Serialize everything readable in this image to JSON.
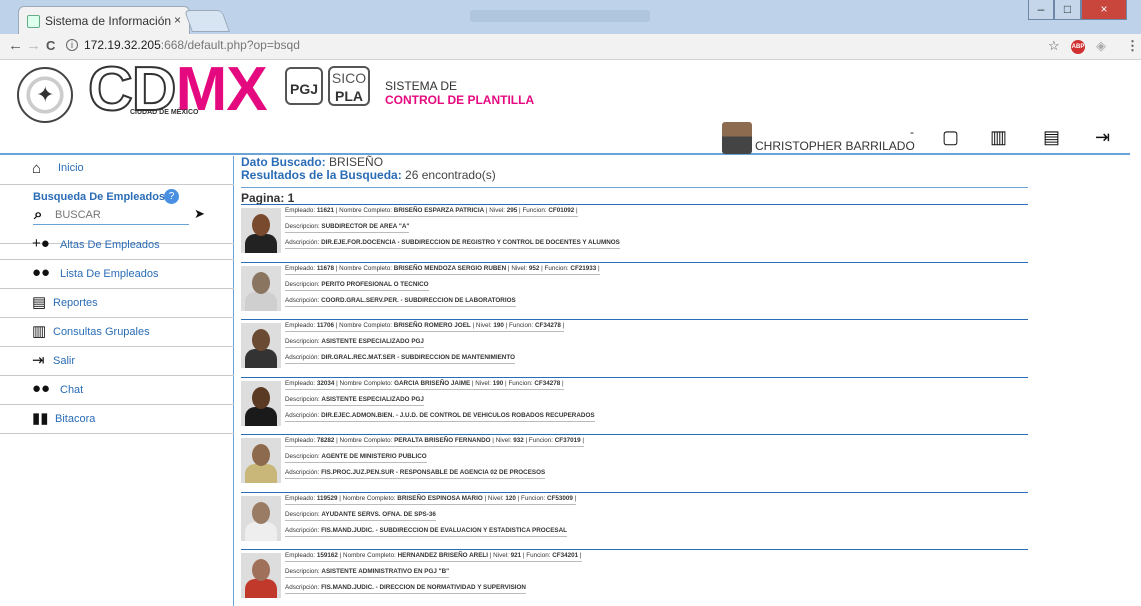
{
  "browser": {
    "tab_title": "Sistema de Información",
    "tab_close": "×",
    "url_host": "172.19.32.205",
    "url_path": ":668/default.php?op=bsqd",
    "back": "←",
    "forward": "→",
    "reload": "C",
    "info": "i",
    "star": "☆",
    "abp": "ABP",
    "minimize": "–",
    "maximize": "□",
    "close": "×"
  },
  "header": {
    "cdmx_cd": "CD",
    "cdmx_mx": "MX",
    "cdmx_sub": "CIUDAD DE MÉXICO",
    "pgj": "PGJ",
    "sico_top": "SICO",
    "sico_bottom": "PLA",
    "sistema_line1": "SISTEMA DE",
    "sistema_line2": "CONTROL DE PLANTILLA",
    "user_name": "CHRISTOPHER BARRILADO",
    "dash": "-"
  },
  "sidebar": {
    "inicio": "Inicio",
    "search_title": "Busqueda De Empleados:",
    "search_placeholder": "BUSCAR",
    "help": "?",
    "altas": "Altas De Empleados",
    "lista": "Lista De Empleados",
    "reportes": "Reportes",
    "consultas": "Consultas Grupales",
    "salir": "Salir",
    "chat": "Chat",
    "bitacora": "Bitacora"
  },
  "main": {
    "dato_label": "Dato Buscado:",
    "dato_value": " BRISEÑO",
    "result_label": "Resultados de la Busqueda:",
    "result_value": " 26 encontrado(s)",
    "pagina": "Pagina: 1",
    "records": [
      {
        "empleado": "11621",
        "nombre": "BRISEÑO ESPARZA PATRICIA",
        "nivel": "295",
        "funcion": "CF01092",
        "descripcion": "SUBDIRECTOR DE AREA \"A\"",
        "adscripcion": "DIR.EJE.FOR.DOCENCIA - SUBDIRECCION DE REGISTRO Y CONTROL DE DOCENTES Y ALUMNOS"
      },
      {
        "empleado": "11678",
        "nombre": "BRISEÑO MENDOZA SERGIO RUBEN",
        "nivel": "952",
        "funcion": "CF21933",
        "descripcion": "PERITO PROFESIONAL O TECNICO",
        "adscripcion": "COORD.GRAL.SERV.PER. - SUBDIRECCION DE LABORATORIOS"
      },
      {
        "empleado": "11706",
        "nombre": "BRISEÑO ROMERO JOEL",
        "nivel": "190",
        "funcion": "CF34278",
        "descripcion": "ASISTENTE ESPECIALIZADO PGJ",
        "adscripcion": "DIR.GRAL.REC.MAT.SER - SUBDIRECCION DE MANTENIMIENTO"
      },
      {
        "empleado": "32034",
        "nombre": "GARCIA BRISEÑO JAIME",
        "nivel": "190",
        "funcion": "CF34278",
        "descripcion": "ASISTENTE ESPECIALIZADO PGJ",
        "adscripcion": "DIR.EJEC.ADMON.BIEN. - J.U.D. DE CONTROL DE VEHICULOS ROBADOS RECUPERADOS"
      },
      {
        "empleado": "78282",
        "nombre": "PERALTA BRISEÑO FERNANDO",
        "nivel": "932",
        "funcion": "CF37019",
        "descripcion": "AGENTE DE MINISTERIO PUBLICO",
        "adscripcion": "FIS.PROC.JUZ.PEN.SUR - RESPONSABLE DE AGENCIA 02 DE PROCESOS"
      },
      {
        "empleado": "119529",
        "nombre": "BRISEÑO ESPINOSA MARIO",
        "nivel": "120",
        "funcion": "CF53009",
        "descripcion": "AYUDANTE SERVS. OFNA. DE SPS-36",
        "adscripcion": "FIS.MAND.JUDIC. - SUBDIRECCION DE EVALUACION Y ESTADISTICA PROCESAL"
      },
      {
        "empleado": "159162",
        "nombre": "HERNANDEZ BRISEÑO ARELI",
        "nivel": "921",
        "funcion": "CF34201",
        "descripcion": "ASISTENTE ADMINISTRATIVO EN PGJ \"B\"",
        "adscripcion": "FIS.MAND.JUDIC. - DIRECCION DE NORMATIVIDAD Y SUPERVISION"
      }
    ],
    "labels": {
      "empleado": "Empleado: ",
      "nombre": "Nombre Completo: ",
      "nivel": "Nivel: ",
      "funcion": "Funcion: ",
      "descripcion": "Descripcion: ",
      "adscripcion": "Adscripción: ",
      "sep": " | "
    }
  },
  "colors": {
    "accent": "#e5097f",
    "link": "#2a6cb5",
    "rule": "#6aa3d5"
  }
}
